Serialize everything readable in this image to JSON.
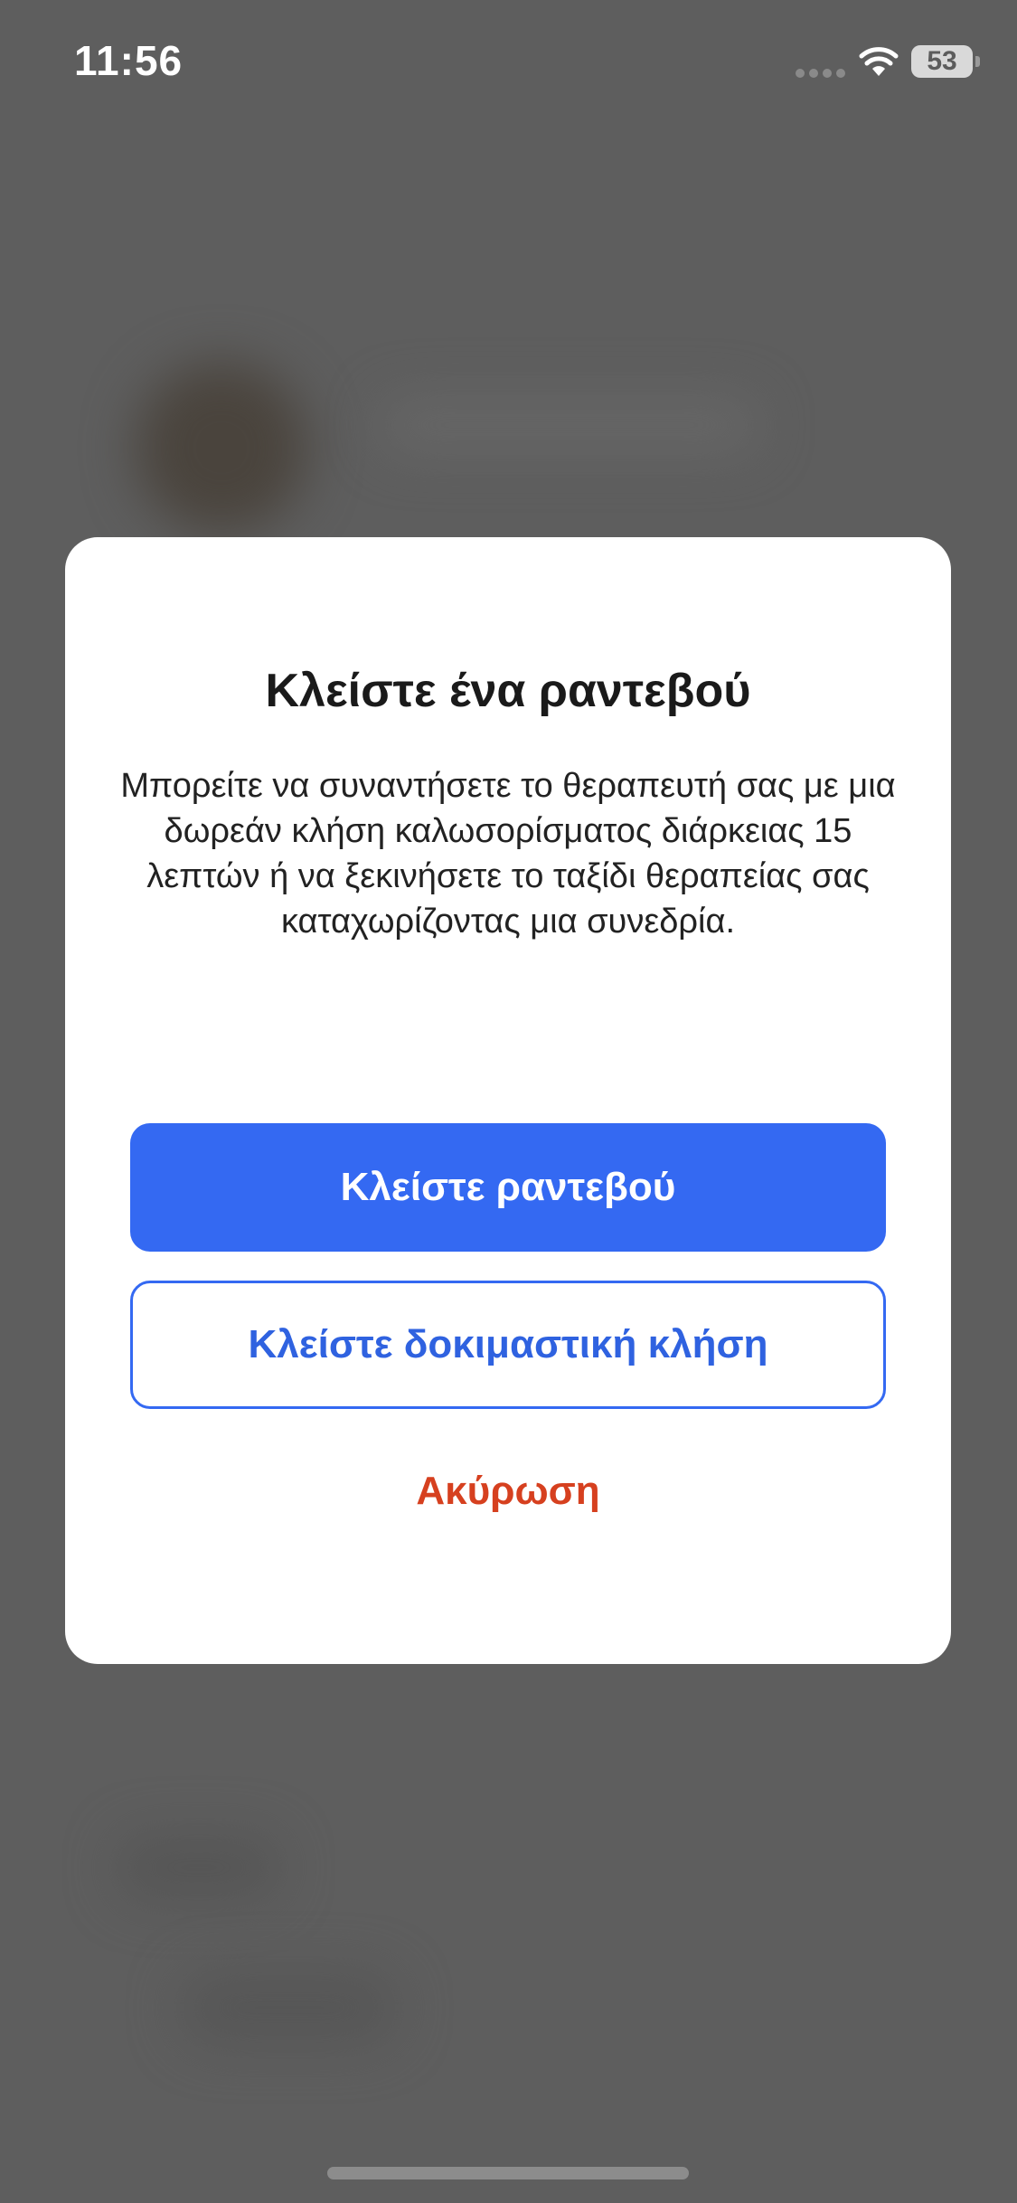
{
  "status_bar": {
    "time": "11:56",
    "battery_level": "53",
    "icons": [
      "cellular-signal-icon",
      "wifi-icon",
      "battery-icon"
    ]
  },
  "modal": {
    "title": "Κλείστε ένα ραντεβού",
    "body": "Μπορείτε να συναντήσετε το θεραπευτή σας με μια δωρεάν κλήση καλωσορίσματος διάρκειας 15 λεπτών ή να ξεκινήσετε το ταξίδι θεραπείας σας καταχωρίζοντας μια συνεδρία.",
    "primary_button": "Κλείστε ραντεβού",
    "secondary_button": "Κλείστε δοκιμαστική κλήση",
    "cancel_button": "Ακύρωση"
  },
  "colors": {
    "primary": "#3469f2",
    "cancel": "#d6401f",
    "overlay": "#5c5c5c"
  }
}
